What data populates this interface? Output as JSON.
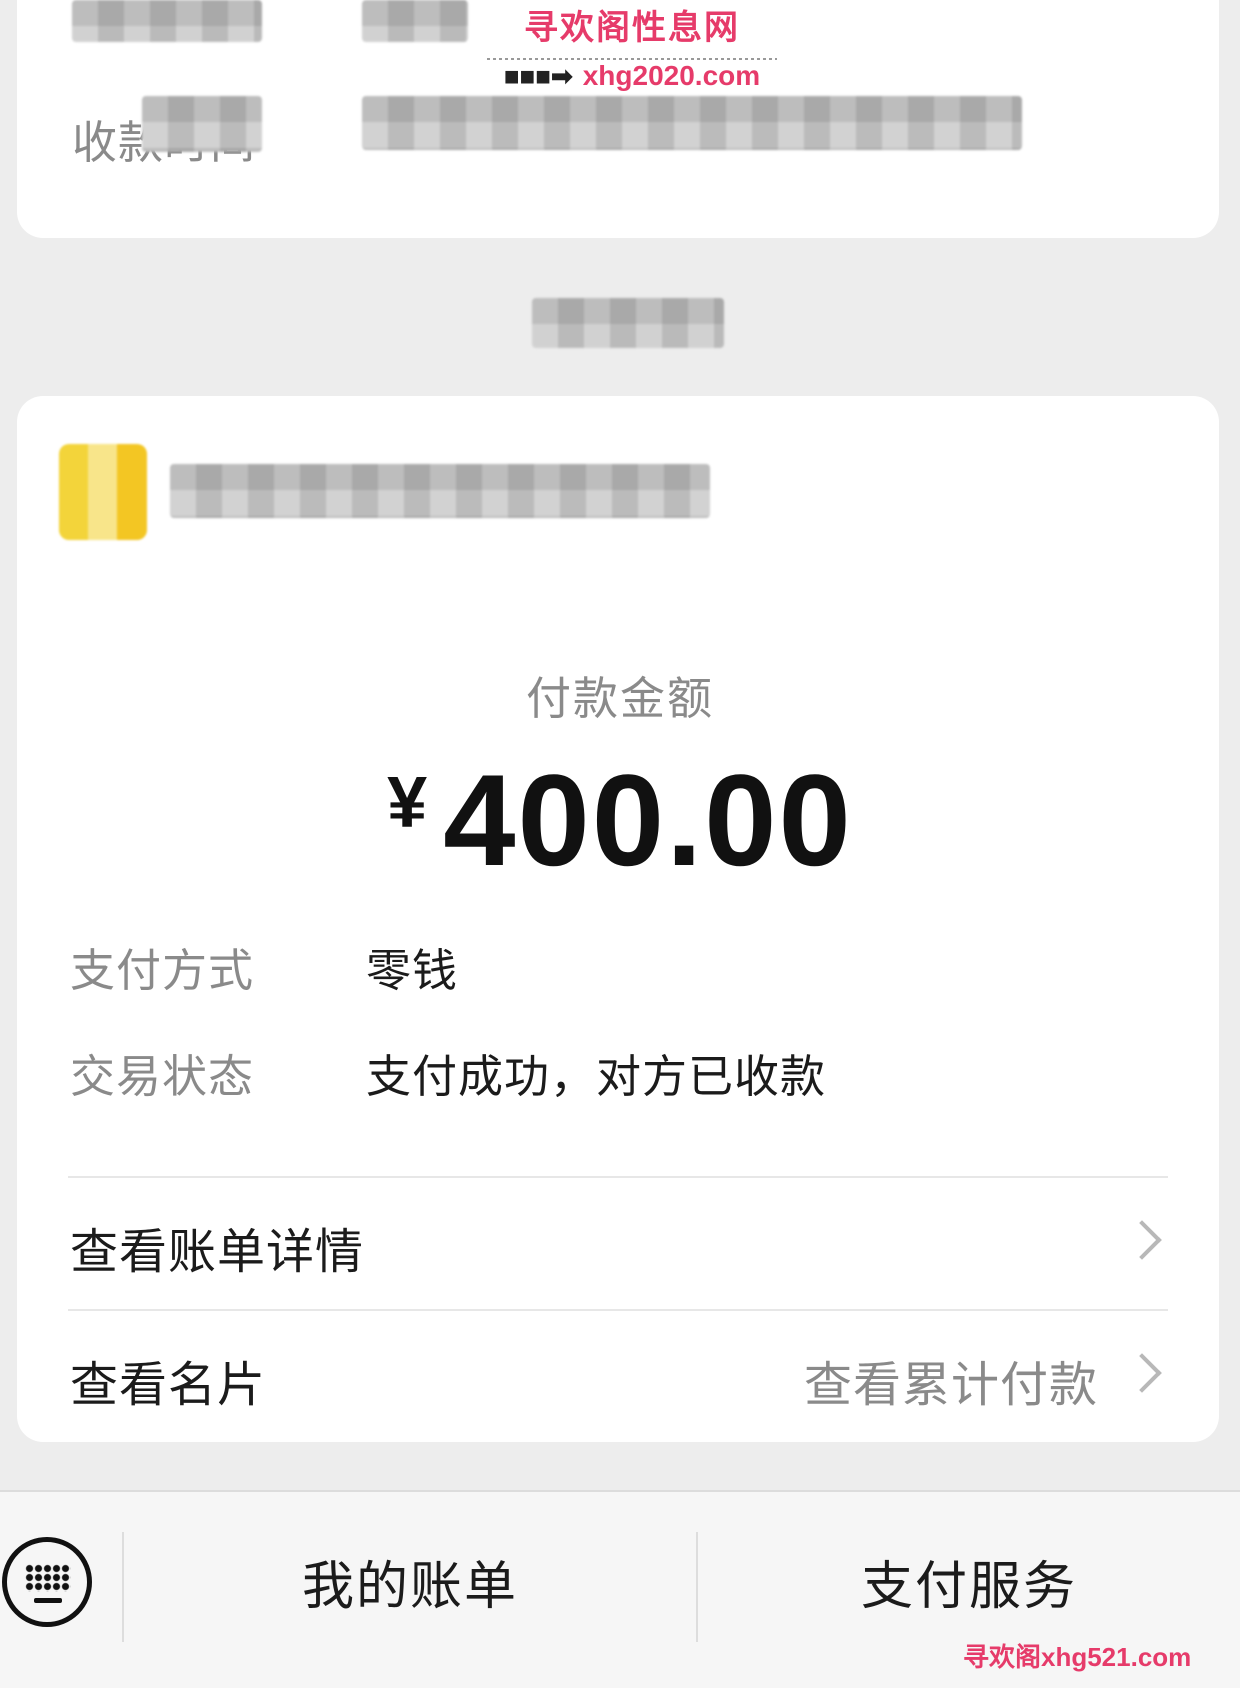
{
  "top_card": {
    "label_2": "收款时间"
  },
  "watermark_top": {
    "name": "寻欢阁性息网",
    "url": "xhg2020.com",
    "arrow": "■■■➡"
  },
  "payment": {
    "amount_title": "付款金额",
    "currency": "¥",
    "amount": "400.00",
    "method_label": "支付方式",
    "method_value": "零钱",
    "status_label": "交易状态",
    "status_value": "支付成功，对方已收款"
  },
  "links": {
    "bill_detail": "查看账单详情",
    "business_card": "查看名片",
    "cumulative": "查看累计付款"
  },
  "bottom_bar": {
    "my_bills": "我的账单",
    "pay_service": "支付服务"
  },
  "watermark_bottom": "寻欢阁xhg521.com"
}
